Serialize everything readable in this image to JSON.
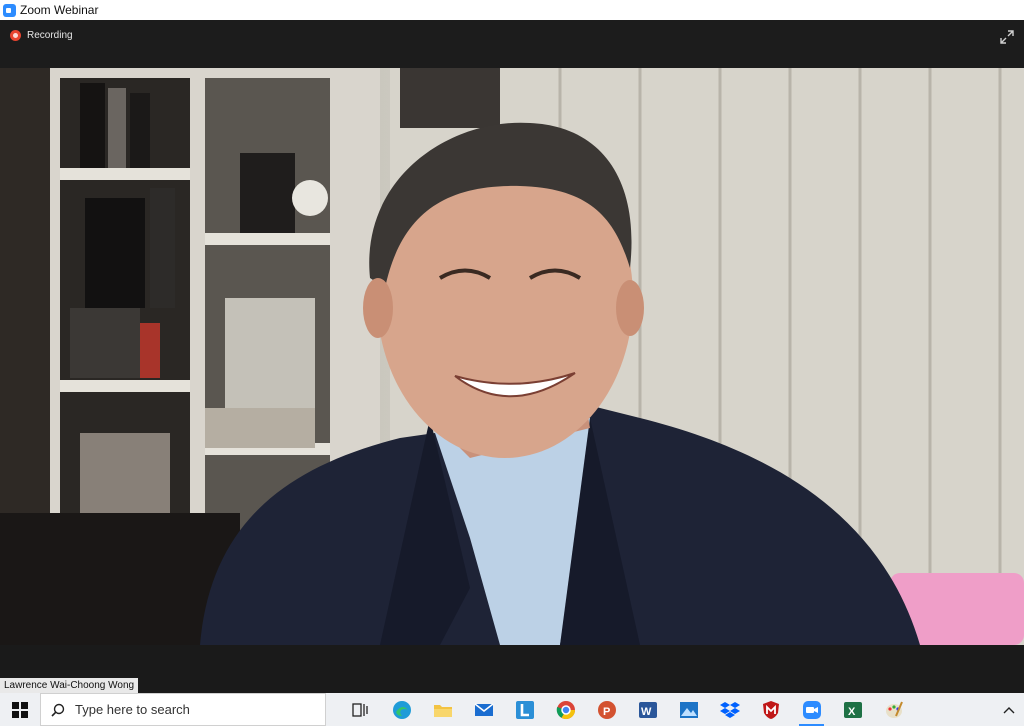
{
  "window": {
    "title": "Zoom Webinar"
  },
  "meeting": {
    "recording_label": "Recording",
    "participant_name": "Lawrence Wai-Choong Wong"
  },
  "taskbar": {
    "search_placeholder": "Type here to search",
    "apps": [
      {
        "name": "task-view"
      },
      {
        "name": "edge"
      },
      {
        "name": "file-explorer"
      },
      {
        "name": "mail"
      },
      {
        "name": "l-app"
      },
      {
        "name": "chrome"
      },
      {
        "name": "powerpoint"
      },
      {
        "name": "word"
      },
      {
        "name": "photos"
      },
      {
        "name": "dropbox"
      },
      {
        "name": "mcafee"
      },
      {
        "name": "zoom"
      },
      {
        "name": "excel"
      },
      {
        "name": "paint"
      }
    ]
  },
  "colors": {
    "accent": "#2d8cff",
    "recording": "#e8442f"
  }
}
